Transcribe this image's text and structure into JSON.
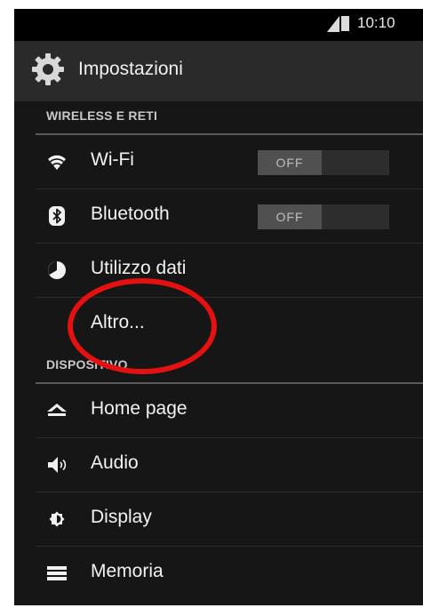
{
  "status_bar": {
    "time": "10:10"
  },
  "action_bar": {
    "title": "Impostazioni",
    "icon": "gear-icon"
  },
  "sections": {
    "wireless": "WIRELESS E RETI",
    "device": "DISPOSITIVO"
  },
  "wireless_items": [
    {
      "label": "Wi-Fi",
      "icon": "wifi-icon",
      "toggle": "OFF"
    },
    {
      "label": "Bluetooth",
      "icon": "bluetooth-icon",
      "toggle": "OFF"
    },
    {
      "label": "Utilizzo dati",
      "icon": "data-usage-icon"
    },
    {
      "label": "Altro..."
    }
  ],
  "device_items": [
    {
      "label": "Home page",
      "icon": "home-icon"
    },
    {
      "label": "Audio",
      "icon": "speaker-icon"
    },
    {
      "label": "Display",
      "icon": "brightness-icon"
    },
    {
      "label": "Memoria",
      "icon": "storage-icon"
    }
  ],
  "colors": {
    "background": "#161616",
    "highlight_circle": "#e51010"
  }
}
